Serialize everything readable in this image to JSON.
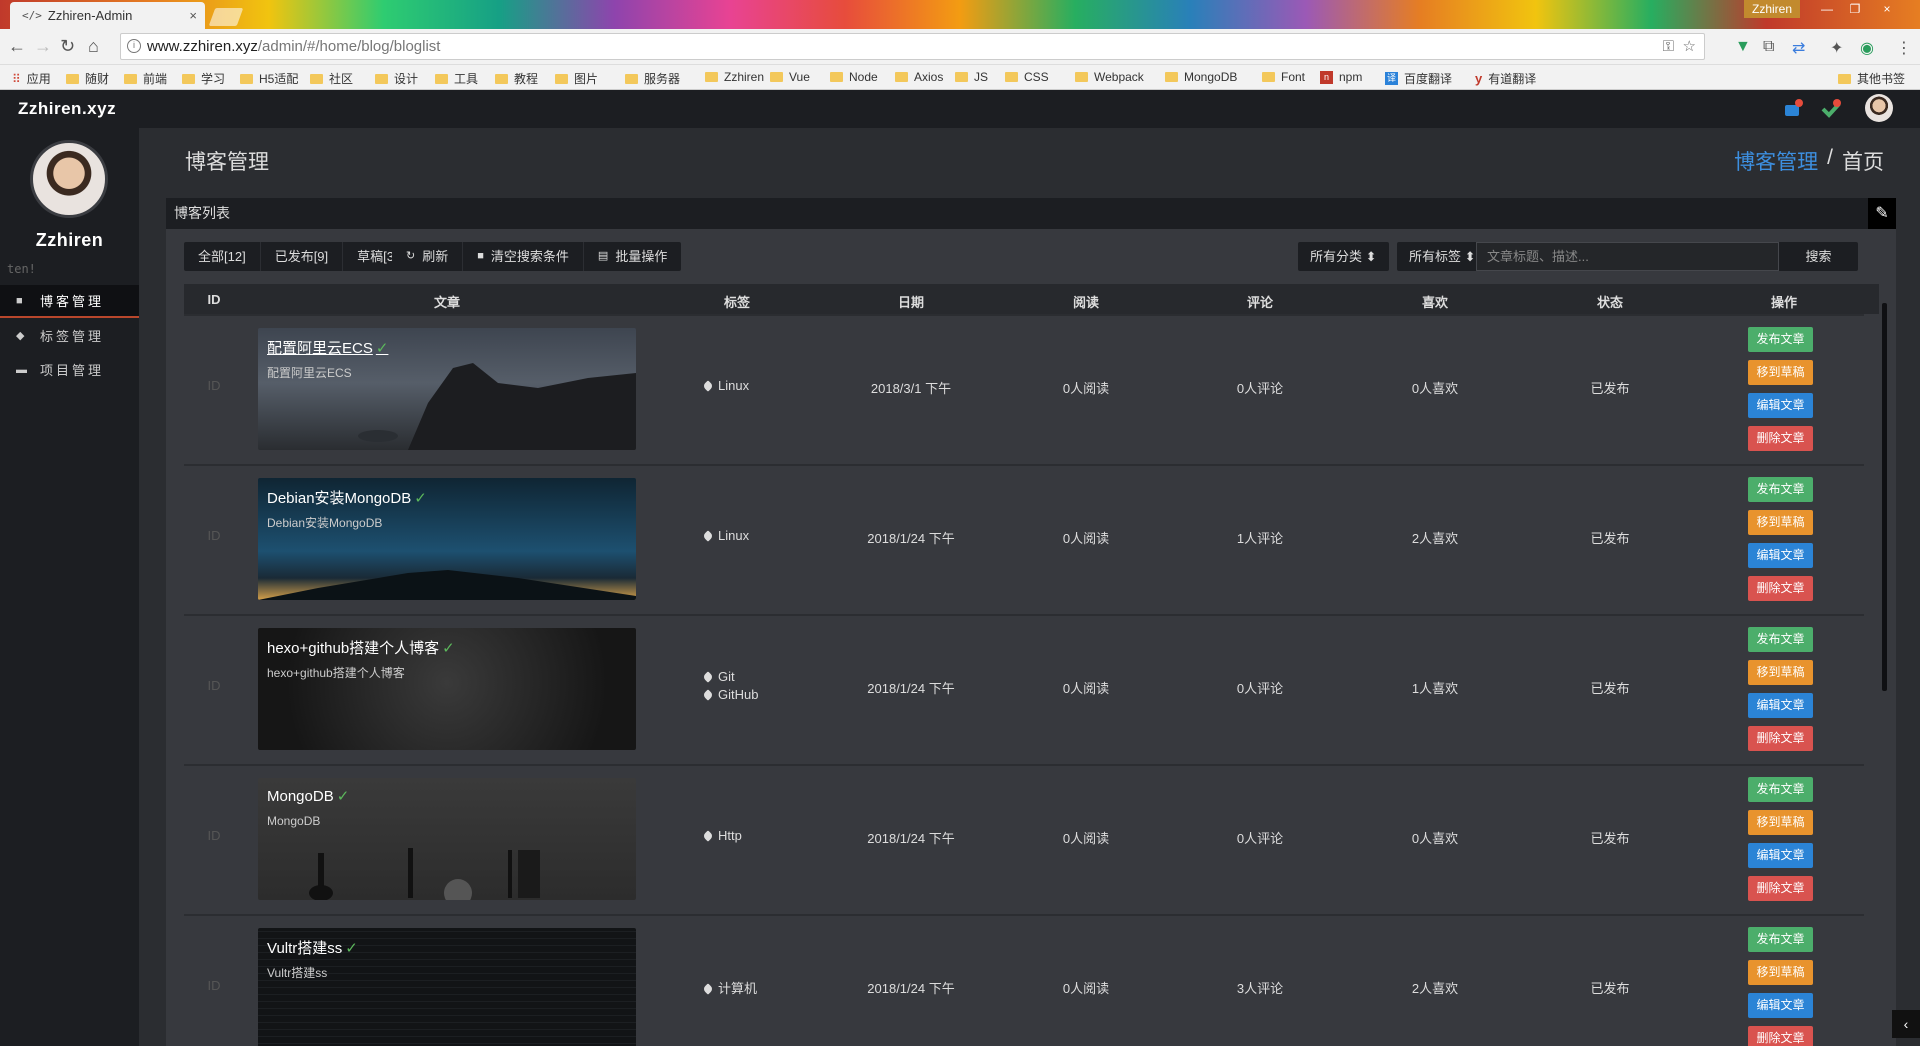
{
  "browser": {
    "tab_title": "Zzhiren-Admin",
    "tab_icon": "</>",
    "close_glyph": "×",
    "window_user": "Zzhiren",
    "url_host": "www.zzhiren.xyz",
    "url_path": "/admin/#/home/blog/bloglist",
    "bookmarks": [
      "应用",
      "随财",
      "前端",
      "学习",
      "H5适配",
      "社区",
      "设计",
      "工具",
      "教程",
      "图片",
      "服务器",
      "Zzhiren",
      "Vue",
      "Node",
      "Axios",
      "JS",
      "CSS",
      "Webpack",
      "MongoDB",
      "Font",
      "npm",
      "百度翻译",
      "有道翻译"
    ],
    "other_bookmarks": "其他书签"
  },
  "app": {
    "brand": "Zzhiren.xyz",
    "username": "Zhiren",
    "username_display": "Zzhiren",
    "tagline": "ten!",
    "sidebar": [
      {
        "label": "博客管理",
        "icon": "book-icon",
        "active": true
      },
      {
        "label": "标签管理",
        "icon": "tag-icon",
        "active": false
      },
      {
        "label": "项目管理",
        "icon": "folder-icon",
        "active": false
      }
    ],
    "page_title": "博客管理",
    "breadcrumb": {
      "link": "博客管理",
      "sep": "/",
      "current": "首页"
    },
    "panel_title": "博客列表",
    "edit_glyph": "✎",
    "filters": {
      "all": "全部[12]",
      "published": "已发布[9]",
      "draft": "草稿[3]"
    },
    "toolbar": {
      "refresh": "刷新",
      "clear": "清空搜索条件",
      "batch": "批量操作"
    },
    "category_select": "所有分类 ⬍",
    "tag_select": "所有标签 ⬍",
    "search_placeholder": "文章标题、描述...",
    "search_button": "搜索",
    "columns": [
      "ID",
      "文章",
      "标签",
      "日期",
      "阅读",
      "评论",
      "喜欢",
      "状态",
      "操作"
    ],
    "action_labels": {
      "publish": "发布文章",
      "draft": "移到草稿",
      "edit": "编辑文章",
      "delete": "删除文章"
    },
    "rows": [
      {
        "id": "ID",
        "title": "配置阿里云ECS",
        "desc": "配置阿里云ECS",
        "tags": [
          "Linux"
        ],
        "date": "2018/3/1 下午",
        "reads": "0人阅读",
        "comments": "0人评论",
        "likes": "0人喜欢",
        "status": "已发布"
      },
      {
        "id": "ID",
        "title": "Debian安装MongoDB",
        "desc": "Debian安装MongoDB",
        "tags": [
          "Linux"
        ],
        "date": "2018/1/24 下午",
        "reads": "0人阅读",
        "comments": "1人评论",
        "likes": "2人喜欢",
        "status": "已发布"
      },
      {
        "id": "ID",
        "title": "hexo+github搭建个人博客",
        "desc": "hexo+github搭建个人博客",
        "tags": [
          "Git",
          "GitHub"
        ],
        "date": "2018/1/24 下午",
        "reads": "0人阅读",
        "comments": "0人评论",
        "likes": "1人喜欢",
        "status": "已发布"
      },
      {
        "id": "ID",
        "title": "MongoDB",
        "desc": "MongoDB",
        "tags": [
          "Http"
        ],
        "date": "2018/1/24 下午",
        "reads": "0人阅读",
        "comments": "0人评论",
        "likes": "0人喜欢",
        "status": "已发布"
      },
      {
        "id": "ID",
        "title": "Vultr搭建ss",
        "desc": "Vultr搭建ss",
        "tags": [
          "计算机"
        ],
        "date": "2018/1/24 下午",
        "reads": "0人阅读",
        "comments": "3人评论",
        "likes": "2人喜欢",
        "status": "已发布"
      }
    ]
  }
}
